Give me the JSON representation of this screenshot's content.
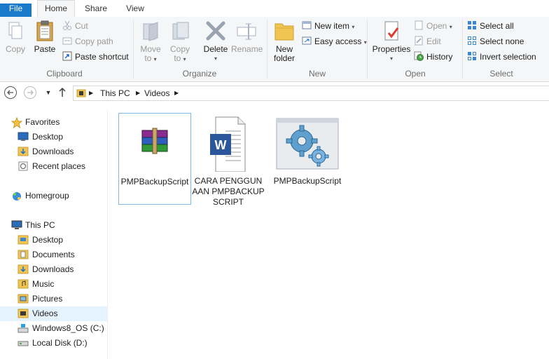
{
  "tabs": {
    "file": "File",
    "home": "Home",
    "share": "Share",
    "view": "View"
  },
  "ribbon": {
    "clipboard": {
      "label": "Clipboard",
      "copy": "Copy",
      "paste": "Paste",
      "cut": "Cut",
      "copy_path": "Copy path",
      "paste_shortcut": "Paste shortcut"
    },
    "organize": {
      "label": "Organize",
      "move_to": "Move",
      "move_to2": "to",
      "copy_to": "Copy",
      "copy_to2": "to",
      "delete": "Delete",
      "rename": "Rename"
    },
    "new": {
      "label": "New",
      "new_folder": "New",
      "new_folder2": "folder",
      "new_item": "New item",
      "easy_access": "Easy access"
    },
    "open": {
      "label": "Open",
      "properties": "Properties",
      "open": "Open",
      "edit": "Edit",
      "history": "History"
    },
    "select": {
      "label": "Select",
      "select_all": "Select all",
      "select_none": "Select none",
      "invert_selection": "Invert selection"
    }
  },
  "address": {
    "crumbs": [
      "This PC",
      "Videos"
    ]
  },
  "sidebar": {
    "favorites": "Favorites",
    "fav_items": [
      "Desktop",
      "Downloads",
      "Recent places"
    ],
    "homegroup": "Homegroup",
    "this_pc": "This PC",
    "pc_items": [
      "Desktop",
      "Documents",
      "Downloads",
      "Music",
      "Pictures",
      "Videos",
      "Windows8_OS (C:)",
      "Local Disk (D:)"
    ]
  },
  "files": [
    {
      "name": "PMPBackupScript",
      "icon": "winrar-archive-icon"
    },
    {
      "name": "CARA PENGGUNAAN PMPBACKUPSCRIPT",
      "icon": "word-document-icon"
    },
    {
      "name": "PMPBackupScript",
      "icon": "gears-application-icon"
    }
  ],
  "colors": {
    "file_tab": "#1979ca",
    "selected": "#e5f3ff",
    "selection_border": "#7fb7e0",
    "word_blue": "#2b579a",
    "folder": "#f0c552"
  }
}
